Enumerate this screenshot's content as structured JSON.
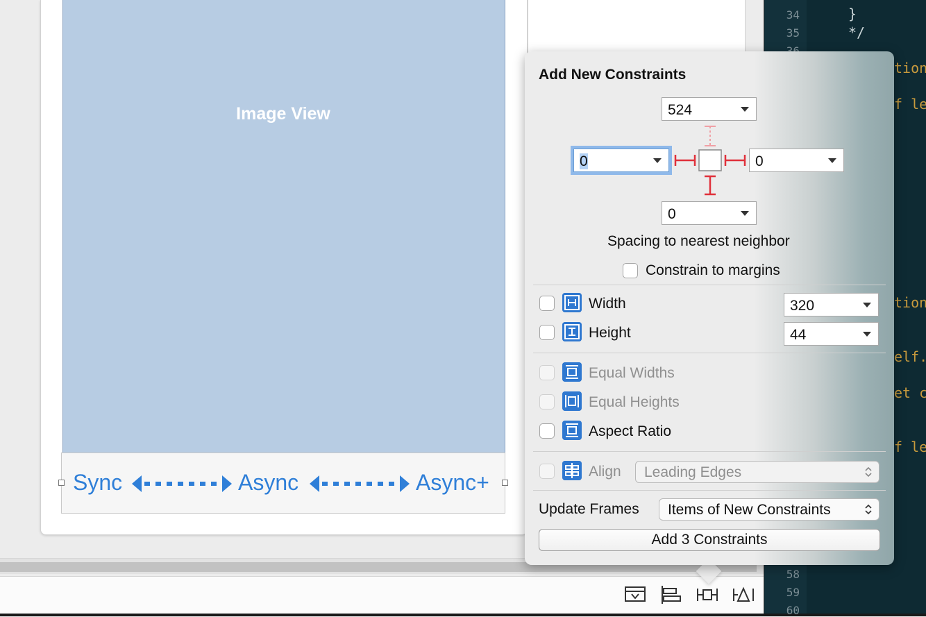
{
  "canvas": {
    "image_view_label": "Image View",
    "segments": [
      "Sync",
      "Async",
      "Async+"
    ]
  },
  "editor": {
    "line_numbers": [
      "34",
      "35",
      "36",
      "58",
      "59",
      "60"
    ],
    "code_fragments": [
      "}",
      "*/",
      "tion",
      "f le",
      "tion",
      "elf.",
      "et c",
      "f le"
    ]
  },
  "popover": {
    "title": "Add New Constraints",
    "top_value": "524",
    "leading_value": "0",
    "trailing_value": "0",
    "bottom_value": "0",
    "spacing_label": "Spacing to nearest neighbor",
    "constrain_margins_label": "Constrain to margins",
    "width_label": "Width",
    "width_value": "320",
    "height_label": "Height",
    "height_value": "44",
    "equal_widths_label": "Equal Widths",
    "equal_heights_label": "Equal Heights",
    "aspect_ratio_label": "Aspect Ratio",
    "align_label": "Align",
    "align_value": "Leading Edges",
    "update_frames_label": "Update Frames",
    "update_frames_value": "Items of New Constraints",
    "add_button_label": "Add 3 Constraints"
  },
  "toolbar": {
    "icons": [
      "update-frames-icon",
      "align-icon",
      "add-constraints-icon",
      "resolve-issues-icon"
    ]
  },
  "colors": {
    "accent_blue": "#2f7fd8",
    "image_view_fill": "#b7cce3",
    "constraint_red": "#e0303a",
    "editor_bg": "#0e2a33"
  }
}
